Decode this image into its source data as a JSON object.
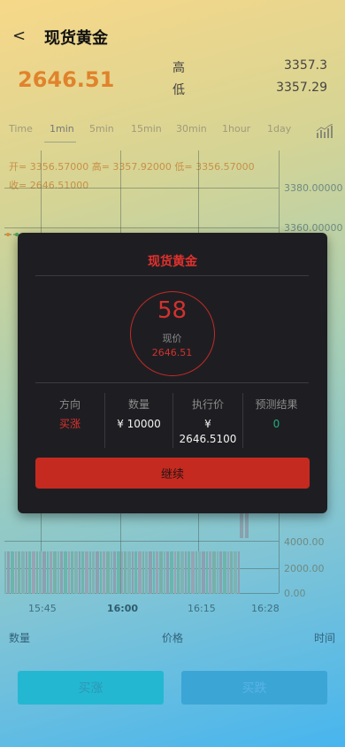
{
  "header": {
    "back_icon": "<",
    "title": "现货黄金"
  },
  "quote": {
    "current_price": "2646.51",
    "high_label": "高",
    "high_value": "3357.3",
    "low_label": "低",
    "low_value": "3357.29"
  },
  "time_tabs": [
    "Time",
    "1min",
    "5min",
    "15min",
    "30min",
    "1hour",
    "1day"
  ],
  "active_tab": "1min",
  "chart_icon": "bar-chart-icon",
  "ohlc": {
    "line1": "开= 3356.57000  高= 3357.92000  低= 3356.57000",
    "line2": "收= 2646.51000"
  },
  "chart_data": {
    "type": "bar",
    "price_axis_labels": [
      "3380.00000",
      "3360.00000"
    ],
    "volume_axis_labels": [
      "4000.00",
      "2000.00",
      "0.00"
    ],
    "x_labels": [
      "15:45",
      "16:00",
      "16:15",
      "16:28"
    ]
  },
  "bottom_labels": {
    "quantity": "数量",
    "price": "价格",
    "time": "时间"
  },
  "buttons": {
    "buy_up": "买涨",
    "buy_down": "买跌"
  },
  "modal": {
    "title": "现货黄金",
    "countdown": "58",
    "current_label": "现价",
    "current_price": "2646.51",
    "direction_label": "方向",
    "direction_value": "买涨",
    "quantity_label": "数量",
    "quantity_value": "¥ 10000",
    "exec_price_label": "执行价",
    "exec_price_currency": "¥",
    "exec_price_value": "2646.5100",
    "result_label": "预测结果",
    "result_value": "0",
    "continue_label": "继续",
    "colors": {
      "accent_red": "#e1312d",
      "result_green": "#1fae7c"
    }
  }
}
